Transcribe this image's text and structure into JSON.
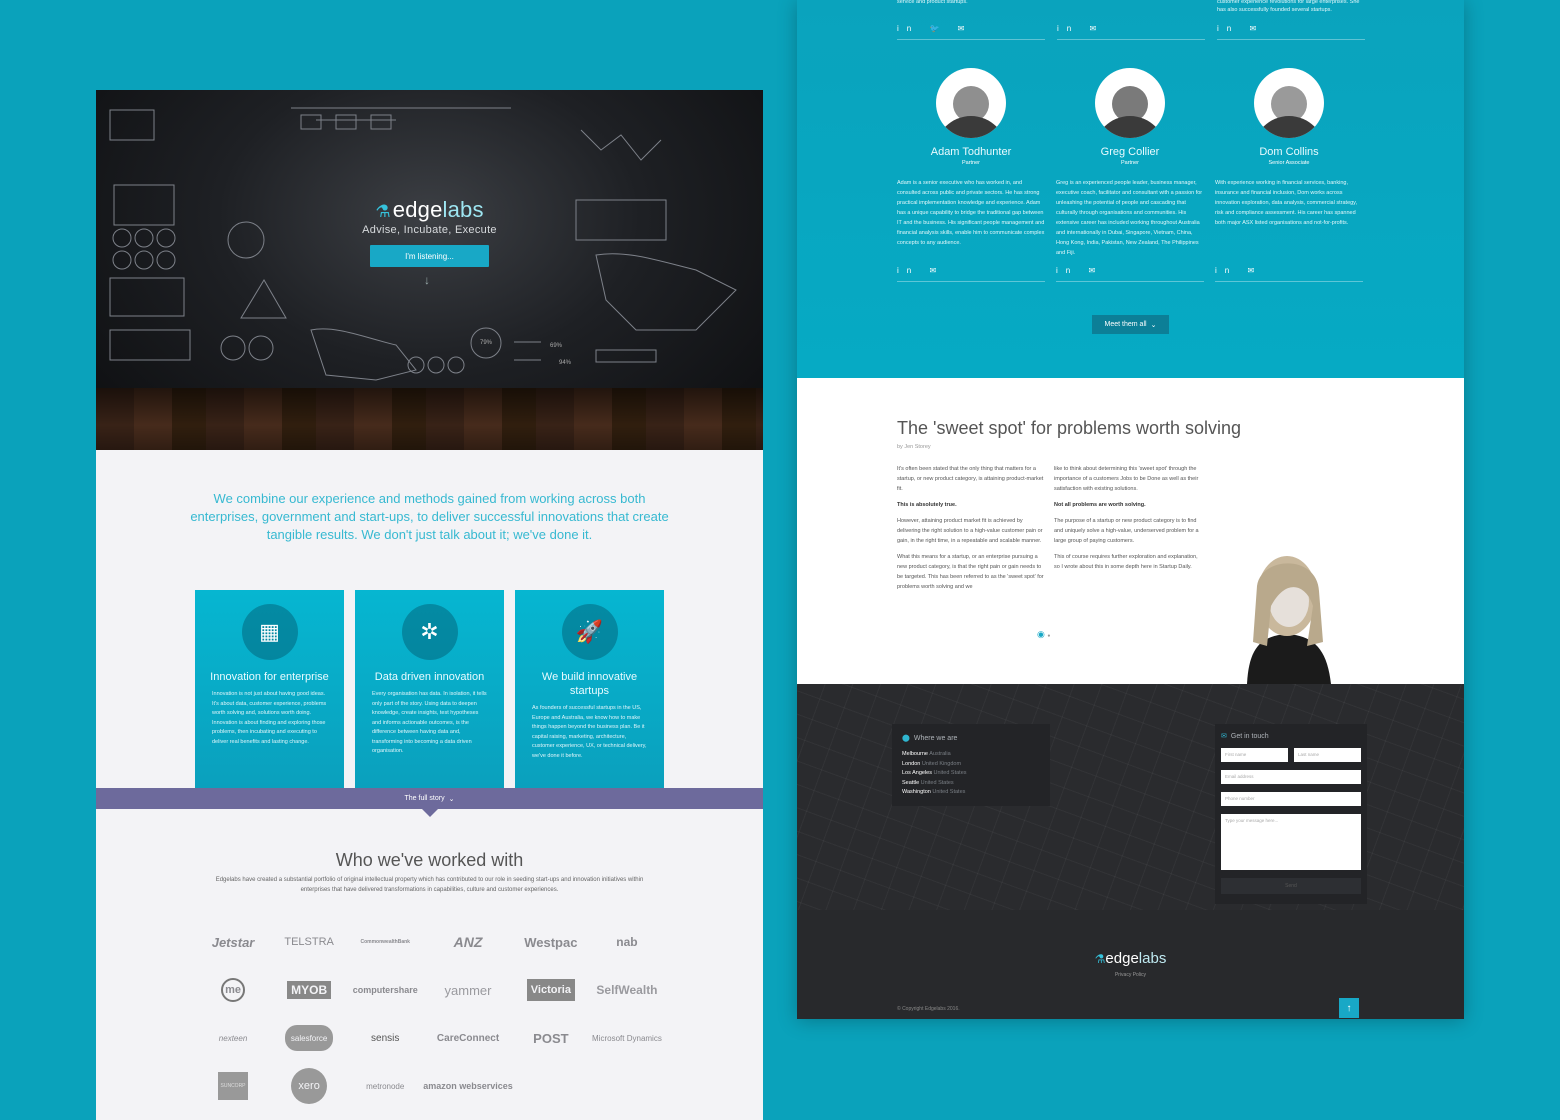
{
  "hero": {
    "logo_prefix": "edge",
    "logo_suffix": "labs",
    "tagline": "Advise, Incubate, Execute",
    "cta": "I'm listening...",
    "chalk_percents": [
      "79%",
      "69%",
      "94%"
    ]
  },
  "intro": "We combine our experience and methods gained from working across both enterprises, government and start-ups, to deliver successful innovations that create tangible results. We don't just talk about it; we've done it.",
  "cards": [
    {
      "icon": "building-icon",
      "title": "Innovation for enterprise",
      "text": "Innovation is not just about having good ideas. It's about data, customer experience, problems worth solving and, solutions worth doing. Innovation is about finding and exploring those problems, then incubating and executing to deliver real benefits and lasting change."
    },
    {
      "icon": "network-icon",
      "title": "Data driven innovation",
      "text": "Every organisation has data. In isolation, it tells only part of the story. Using data to deepen knowledge, create insights, test hypotheses and informs actionable outcomes, is the difference between having data and, transforming into becoming a data driven organisation."
    },
    {
      "icon": "rocket-icon",
      "title": "We build innovative startups",
      "text": "As founders of successful startups in the US, Europe and Australia, we know how to make things happen beyond the business plan. Be it capital raising, marketing, architecture, customer experience, UX, or technical delivery, we've done it before."
    }
  ],
  "full_story": "The full story",
  "clients_title": "Who we've worked with",
  "clients_desc": "Edgelabs have created a substantial portfolio of original intellectual property which has contributed to our role in seeding start-ups and innovation initiatives within enterprises that have delivered transformations in capabilities, culture and customer experiences.",
  "clients": [
    "Jetstar",
    "TELSTRA",
    "CommonwealthBank",
    "ANZ",
    "Westpac",
    "nab",
    "me",
    "MYOB",
    "computershare",
    "yammer",
    "Victoria",
    "SelfWealth",
    "nexteen",
    "salesforce",
    "sensis",
    "CareConnect",
    "POST",
    "Microsoft Dynamics",
    "SUNCORP",
    "xero",
    "metronode",
    "amazon webservices"
  ],
  "team_top": [
    {
      "text": "service and product startups."
    },
    {
      "text": ""
    },
    {
      "text": "customer experience revolutions for large enterprises. She has also successfully founded several startups."
    }
  ],
  "team": [
    {
      "name": "Adam Todhunter",
      "role": "Partner",
      "bio": "Adam is a senior executive who has worked in, and consulted across public and private sectors. He has strong practical implementation knowledge and experience. Adam has a unique capability to bridge the traditional gap between IT and the business. His significant people management and financial analysis skills, enable him to communicate complex concepts to any audience."
    },
    {
      "name": "Greg Collier",
      "role": "Partner",
      "bio": "Greg is an experienced people leader, business manager, executive coach, facilitator and consultant with a passion for unleashing the potential of people and cascading that culturally through organisations and communities. His extensive career has included working throughout Australia and internationally in Dubai, Singapore, Vietnam, China, Hong Kong, India, Pakistan, New Zealand, The Philippines and Fiji."
    },
    {
      "name": "Dom Collins",
      "role": "Senior Associate",
      "bio": "With experience working in financial services, banking, insurance and financial inclusion, Dom works across innovation exploration, data analysis, commercial strategy, risk and compliance assessment. His career has spanned both major ASX listed organisations and not-for-profits."
    }
  ],
  "meet_all": "Meet them all",
  "blog": {
    "title": "The 'sweet spot' for problems worth solving",
    "byline": "by Jen Storey",
    "colA": [
      {
        "t": "It's often been stated that the only thing that matters for a startup, or new product category, is attaining product-market fit.",
        "b": false
      },
      {
        "t": "This is absolutely true.",
        "b": true
      },
      {
        "t": "However, attaining product market fit is achieved by delivering the right solution to a high-value customer pain or gain, in the right time, in a repeatable and scalable manner.",
        "b": false
      },
      {
        "t": "What this means for a startup, or an enterprise pursuing a new product category, is that the right pain or gain needs to be targeted. This has been referred to as the 'sweet spot' for problems worth solving and we",
        "b": false
      }
    ],
    "colB": [
      {
        "t": "like to think about determining this 'sweet spot' through the importance of a customers Jobs to be Done as well as their satisfaction with existing solutions.",
        "b": false
      },
      {
        "t": "Not all problems are worth solving.",
        "b": true
      },
      {
        "t": "The purpose of a startup or new product category is to find and uniquely solve a high-value, underserved problem for a large group of paying customers.",
        "b": false
      },
      {
        "t": "This of course requires further exploration and explanation, so I wrote about this in some depth here in Startup Daily.",
        "b": false
      }
    ]
  },
  "where": {
    "title": "Where we are",
    "offices": [
      {
        "city": "Melbourne",
        "country": "Australia"
      },
      {
        "city": "London",
        "country": "United Kingdom"
      },
      {
        "city": "Los Angeles",
        "country": "United States"
      },
      {
        "city": "Seattle",
        "country": "United States"
      },
      {
        "city": "Washington",
        "country": "United States"
      }
    ]
  },
  "contact": {
    "title": "Get in touch",
    "first": "First name",
    "last": "Last name",
    "email": "Email address",
    "phone": "Phone number",
    "message": "Type your message here...",
    "send": "Send"
  },
  "footer": {
    "logo_prefix": "edge",
    "logo_suffix": "labs",
    "privacy": "Privacy Policy",
    "copyright": "© Copyright Edgelabs 2016."
  },
  "colors": {
    "accent": "#18a8c6",
    "background": "#0aa2bb",
    "story_bar": "#6d6a9c"
  }
}
